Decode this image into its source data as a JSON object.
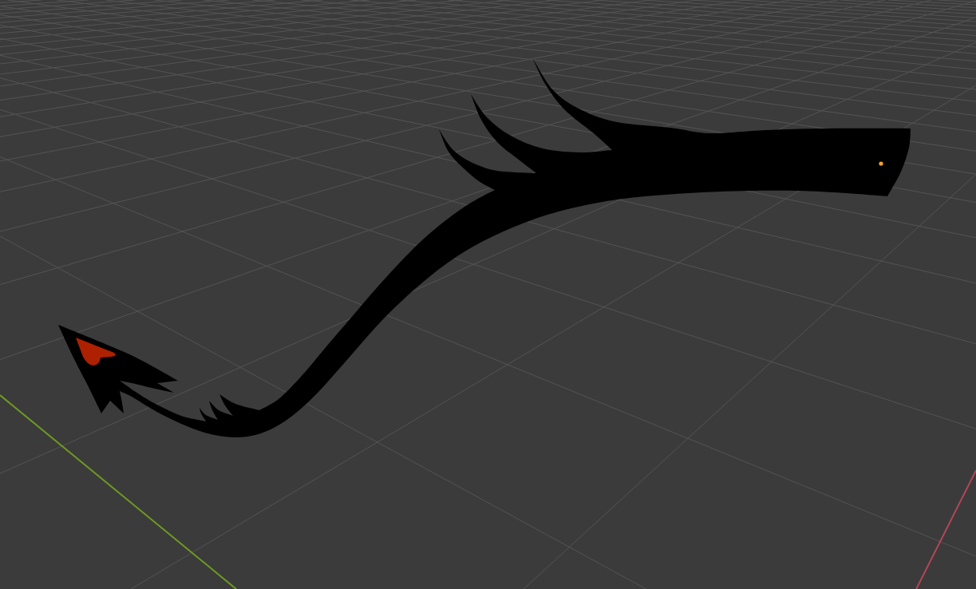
{
  "viewport": {
    "grid": true,
    "axes": [
      {
        "kind": "x",
        "color": "#b3475b"
      },
      {
        "kind": "y",
        "color": "#6f9a22"
      }
    ],
    "object": {
      "kind": "tail",
      "origin_visible": true
    }
  }
}
